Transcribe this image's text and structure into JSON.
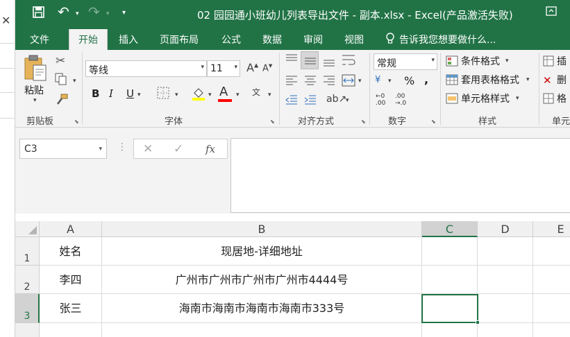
{
  "title_bar": {
    "title": "02 园园通小班幼儿列表导出文件 - 副本.xlsx - Excel(产品激活失败)"
  },
  "ribbon_tabs": [
    "文件",
    "开始",
    "插入",
    "页面布局",
    "公式",
    "数据",
    "审阅",
    "视图"
  ],
  "tell_me": "告诉我您想要做什么...",
  "clipboard": {
    "paste_label": "粘贴",
    "group_label": "剪贴板"
  },
  "font": {
    "name": "等线",
    "size": "11",
    "group_label": "字体"
  },
  "alignment": {
    "group_label": "对齐方式"
  },
  "number": {
    "format": "常规",
    "group_label": "数字"
  },
  "styles": {
    "conditional": "条件格式",
    "table": "套用表格格式",
    "cell_styles": "单元格样式",
    "group_label": "样式"
  },
  "cells": {
    "insert": "插",
    "delete": "删",
    "format": "格",
    "group_label": "单元"
  },
  "formula_bar": {
    "name_box": "C3",
    "fx": "fx",
    "value": ""
  },
  "columns": [
    "A",
    "B",
    "C",
    "D",
    "E"
  ],
  "rows": [
    {
      "num": "1",
      "a": "姓名",
      "b": "现居地-详细地址"
    },
    {
      "num": "2",
      "a": "李四",
      "b": "广州市广州市广州市广州市4444号"
    },
    {
      "num": "3",
      "a": "张三",
      "b": "海南市海南市海南市海南市333号"
    }
  ],
  "colors": {
    "accent": "#217346",
    "font_underline": "#ff0000",
    "highlight": "#ffff00"
  }
}
